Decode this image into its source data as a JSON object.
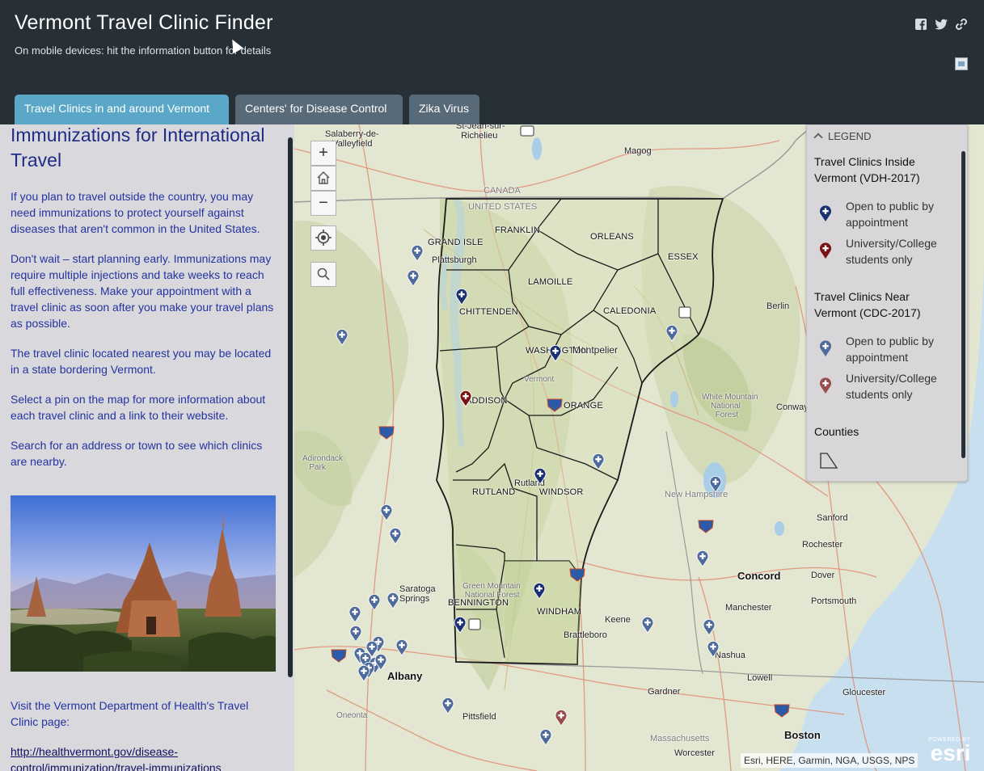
{
  "header": {
    "title": "Vermont Travel Clinic Finder",
    "subtitle": "On mobile devices: hit the information button for details",
    "share": [
      "facebook-icon",
      "twitter-icon",
      "link-icon"
    ],
    "background": "#263036"
  },
  "tabs": [
    {
      "label": "Travel Clinics in and around Vermont",
      "active": true
    },
    {
      "label": "Centers' for Disease Control",
      "active": false
    },
    {
      "label": "Zika Virus",
      "active": false
    }
  ],
  "side_panel": {
    "heading": "Immunizations for International Travel",
    "paragraphs": [
      "If you plan to travel outside the country, you may need immunizations to protect yourself against diseases that aren't common in the United States.",
      "Don't wait – start planning early. Immunizations may require multiple injections and take weeks to reach full effectiveness. Make your appointment with a travel clinic as soon after you make your travel plans as possible.",
      "The travel clinic located nearest you may be located in a state bordering Vermont.",
      "Select a pin on the map for more information about each travel clinic and a link to their website.",
      "Search for an address or town to see which clinics are nearby."
    ],
    "visit_text": "Visit the Vermont Department of Health's Travel Clinic page:",
    "link_text": "http://healthvermont.gov/disease-control/immunization/travel-immunizations"
  },
  "map_controls": {
    "zoom_in": "+",
    "zoom_out": "−",
    "home_icon": "home-icon",
    "locate_icon": "locate-icon",
    "search_icon": "search-icon"
  },
  "map_labels": {
    "counties": [
      "GRAND ISLE",
      "FRANKLIN",
      "ORLEANS",
      "ESSEX",
      "LAMOILLE",
      "CHITTENDEN",
      "CALEDONIA",
      "WASHINGTON",
      "ADDISON",
      "ORANGE",
      "RUTLAND",
      "WINDSOR",
      "BENNINGTON",
      "WINDHAM"
    ],
    "places": [
      "Salaberry-de-Valleyfield",
      "St-Jean-sur-Richelieu",
      "Magog",
      "CANADA",
      "UNITED STATES",
      "Plattsburgh",
      "Montpelier",
      "Vermont",
      "Berlin",
      "White Mountain National Forest",
      "Conway",
      "Adirondack Park",
      "New Hampshire",
      "Sanford",
      "Rochester",
      "Dover",
      "Portsmouth",
      "Concord",
      "Manchester",
      "Keene",
      "Brattleboro",
      "Nashua",
      "Lowell",
      "Gloucester",
      "Gardner",
      "Saratoga Springs",
      "Albany",
      "Pittsfield",
      "Massachusetts",
      "Worcester",
      "Boston",
      "Green Mountain National Forest",
      "Oneonta",
      "Rutland"
    ]
  },
  "legend": {
    "toggle_label": "LEGEND",
    "groups": [
      {
        "title": "Travel Clinics Inside Vermont (VDH-2017)",
        "items": [
          {
            "label": "Open to public by appointment",
            "color": "#1a2f74"
          },
          {
            "label": "University/College students only",
            "color": "#7a1212"
          }
        ]
      },
      {
        "title": "Travel Clinics Near Vermont (CDC-2017)",
        "items": [
          {
            "label": "Open to public by appointment",
            "color": "#4f6b9c"
          },
          {
            "label": "University/College students only",
            "color": "#9a4b4b"
          }
        ]
      }
    ],
    "counties_title": "Counties"
  },
  "attribution": "Esri, HERE, Garmin, NGA, USGS, NPS",
  "esri_logo": {
    "powered": "POWERED BY",
    "name": "esri"
  }
}
